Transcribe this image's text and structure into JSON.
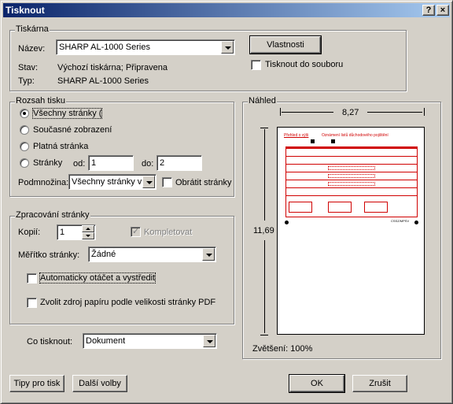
{
  "window": {
    "title": "Tisknout",
    "help_label": "?",
    "close_label": "×"
  },
  "printer": {
    "legend": "Tiskárna",
    "name_label": "Název:",
    "name_value": "SHARP AL-1000 Series",
    "status_label": "Stav:",
    "status_value": "Výchozí tiskárna; Připravena",
    "type_label": "Typ:",
    "type_value": "SHARP AL-1000 Series",
    "properties_button": "Vlastnosti",
    "print_to_file_label": "Tisknout do souboru",
    "print_to_file_checked": false
  },
  "range": {
    "legend": "Rozsah tisku",
    "options": [
      "Všechny stránky (",
      "Současné zobrazení",
      "Platná stránka",
      "Stránky"
    ],
    "selected_index": 0,
    "from_label": "od:",
    "from_value": "1",
    "to_label": "do:",
    "to_value": "2",
    "subset_label": "Podmnožina:",
    "subset_value": "Všechny stránky v",
    "reverse_label": "Obrátit stránky",
    "reverse_checked": false
  },
  "handling": {
    "legend": "Zpracování stránky",
    "copies_label": "Kopií:",
    "copies_value": "1",
    "collate_label": "Kompletovat",
    "collate_checked": true,
    "scale_label": "Měřítko stránky:",
    "scale_value": "Žádné",
    "auto_rotate_label": "Automaticky otáčet a vystředit",
    "auto_rotate_checked": false,
    "paper_source_label": "Zvolit zdroj papíru podle velikosti stránky PDF",
    "paper_source_checked": false
  },
  "print_what": {
    "label": "Co tisknout:",
    "value": "Dokument"
  },
  "preview": {
    "legend": "Náhled",
    "width_value": "8,27",
    "height_value": "11,69",
    "zoom_text": "Zvětšení: 100%",
    "doc_title_left": "Přehled o výši",
    "doc_title_center": "Oznámení listů důchodového pojištění",
    "doc_footer": "CSSZ/MPSV",
    "accent_color": "#d00000"
  },
  "buttons": {
    "tips": "Tipy pro tisk",
    "more_options": "Další volby",
    "ok": "OK",
    "cancel": "Zrušit"
  }
}
